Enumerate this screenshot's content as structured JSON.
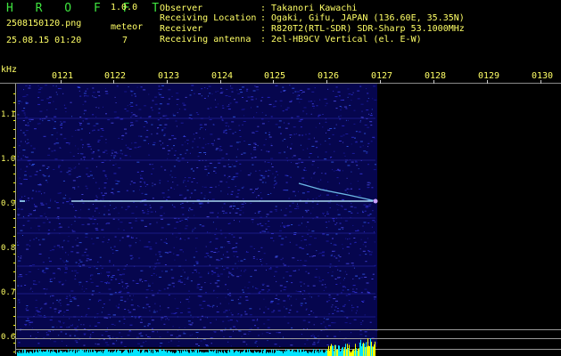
{
  "app": {
    "name": "H R O F F T",
    "version": "1.0.0"
  },
  "file": {
    "name": "2508150120.png",
    "datetime": "25.08.15 01:20"
  },
  "meteor": {
    "label": "meteor",
    "count": "7"
  },
  "station": {
    "observer_key": "Observer",
    "observer_value": ": Takanori Kawachi",
    "location_key": "Receiving Location",
    "location_value": ": Ogaki, Gifu, JAPAN (136.60E, 35.35N)",
    "receiver_key": "Receiver",
    "receiver_value": ": R820T2(RTL-SDR) SDR-Sharp 53.1000MHz",
    "antenna_key": "Receiving antenna",
    "antenna_value": ": 2el-HB9CV Vertical (el. E-W)"
  },
  "axis": {
    "unit": "kHz",
    "time_ticks": [
      "0121",
      "0122",
      "0123",
      "0124",
      "0125",
      "0126",
      "0127",
      "0128",
      "0129",
      "0130"
    ],
    "freq_ticks": [
      "1.1",
      "1.0",
      "0.9",
      "0.8",
      "0.7",
      "0.6"
    ]
  },
  "colors": {
    "background": "#000000",
    "header_text": "#ffff66",
    "app_name": "#3fe43f",
    "noise_base": "#0a0a6e",
    "trace": "#aee9ff",
    "level_bar": "#00e5ff",
    "level_peak": "#ffff00"
  }
}
